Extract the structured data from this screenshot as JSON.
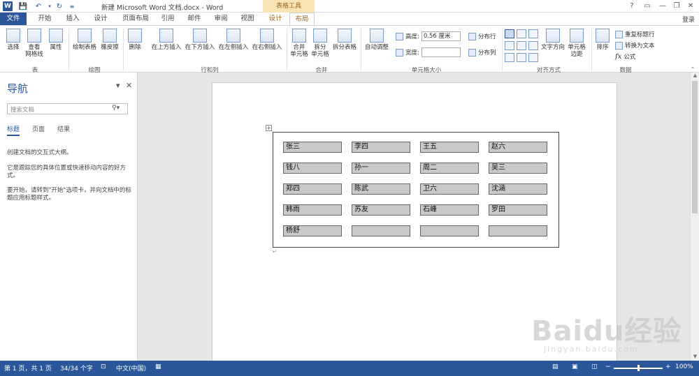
{
  "window": {
    "title": "新建 Microsoft Word 文档.docx - Word",
    "context_tools": "表格工具",
    "controls": [
      "?",
      "▭",
      "—",
      "❐",
      "✕"
    ]
  },
  "tabs": [
    {
      "label": "文件"
    },
    {
      "label": "开始"
    },
    {
      "label": "插入"
    },
    {
      "label": "设计"
    },
    {
      "label": "页面布局"
    },
    {
      "label": "引用"
    },
    {
      "label": "邮件"
    },
    {
      "label": "审阅"
    },
    {
      "label": "视图"
    },
    {
      "label": "设计"
    },
    {
      "label": "布局"
    }
  ],
  "login": "登录",
  "ribbon": {
    "table": {
      "select": "选择",
      "gridlines": "查看\n网格线",
      "properties": "属性",
      "label": "表"
    },
    "draw": {
      "draw_table": "绘制表格",
      "eraser": "橡皮擦",
      "label": "绘图"
    },
    "rows_cols": {
      "delete": "删除",
      "insert_above": "在上方插入",
      "insert_below": "在下方插入",
      "insert_left": "在左侧插入",
      "insert_right": "在右侧插入",
      "label": "行和列"
    },
    "merge": {
      "merge_cells": "合并\n单元格",
      "split_cells": "拆分\n单元格",
      "split_table": "拆分表格",
      "label": "合并"
    },
    "cell_size": {
      "autofit": "自动调整",
      "height_label": "高度:",
      "height_value": "0.56 厘米",
      "width_label": "宽度:",
      "width_value": "",
      "distribute_rows": "分布行",
      "distribute_cols": "分布列",
      "label": "单元格大小"
    },
    "alignment": {
      "text_direction": "文字方向",
      "cell_margins": "单元格\n边距",
      "label": "对齐方式"
    },
    "data": {
      "sort": "排序",
      "repeat_header": "重复标题行",
      "convert_text": "转换为文本",
      "formula": "公式",
      "label": "数据"
    }
  },
  "nav_pane": {
    "title": "导航",
    "search_placeholder": "搜索文档",
    "tabs": [
      "标题",
      "页面",
      "结果"
    ],
    "text1": "创建文档的交互式大纲。",
    "text2": "它是跟踪您的具体位置或快速移动内容的好方式。",
    "text3": "要开始，请转到\"开始\"选项卡，并向文档中的标题应用标题样式。"
  },
  "table": {
    "rows": [
      [
        "张三",
        "李四",
        "王五",
        "赵六"
      ],
      [
        "钱八",
        "孙一",
        "周二",
        "吴三"
      ],
      [
        "郑四",
        "陈武",
        "卫六",
        "沈涵"
      ],
      [
        "韩雨",
        "苏友",
        "石峰",
        "罗田"
      ],
      [
        "杨舒",
        "",
        "",
        ""
      ]
    ],
    "para_mark": "↵"
  },
  "status": {
    "page": "第 1 页，共 1 页",
    "words": "34/34 个字",
    "language": "中文(中国)",
    "zoom": "100%"
  },
  "watermark": {
    "brand": "Baidu经验",
    "url": "jingyan.baidu.com"
  }
}
